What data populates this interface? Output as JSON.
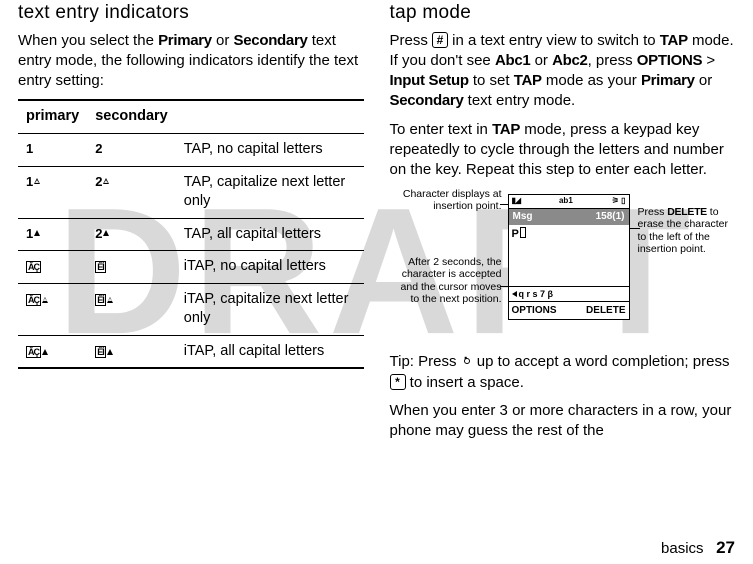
{
  "watermark": "DRAFT",
  "left": {
    "heading": "text entry indicators",
    "intro_pre": "When you select the ",
    "primary_word": "Primary",
    "intro_mid": " or ",
    "secondary_word": "Secondary",
    "intro_post": " text entry mode, the following indicators identify the text entry setting:",
    "table": {
      "h1": "primary",
      "h2": "secondary",
      "rows": [
        {
          "p": "1",
          "s": "2",
          "arrow": "none",
          "desc": "TAP, no capital letters"
        },
        {
          "p": "1",
          "s": "2",
          "arrow": "outline",
          "desc": "TAP, capitalize next letter only"
        },
        {
          "p": "1",
          "s": "2",
          "arrow": "solid",
          "desc": "TAP, all capital letters"
        },
        {
          "p": "box",
          "s": "box",
          "arrow": "none",
          "desc": "iTAP, no capital letters"
        },
        {
          "p": "box",
          "s": "box",
          "arrow": "outline",
          "desc": "iTAP, capitalize next letter only"
        },
        {
          "p": "box",
          "s": "box",
          "arrow": "solid",
          "desc": "iTAP, all capital letters"
        }
      ],
      "box_glyph_p": "ÂÇ",
      "box_glyph_s": "ÊÌ"
    }
  },
  "right": {
    "heading": "tap mode",
    "p1_a": "Press ",
    "p1_hash": "#",
    "p1_b": " in a text entry view to switch to ",
    "p1_tap": "TAP",
    "p1_c": " mode. If you don't see ",
    "p1_abc1": "Abc1",
    "p1_d": " or ",
    "p1_abc2": "Abc2",
    "p1_e": ", press ",
    "p1_options": "OPTIONS",
    "p1_gt": " > ",
    "p1_input": "Input Setup",
    "p1_f": " to set ",
    "p1_g": " mode as your ",
    "p1_h": " or ",
    "p1_i": " text entry mode.",
    "p2_a": "To enter text in ",
    "p2_b": " mode, press a keypad key repeatedly to cycle through the letters and number on the key. Repeat this step to enter each letter.",
    "callout_left1": "Character displays at insertion point.",
    "callout_left2": "After 2 seconds, the character is accepted and the cursor moves to the next position.",
    "callout_right_a": "Press ",
    "callout_right_del": "DELETE",
    "callout_right_b": " to erase the character to the left of the insertion point.",
    "phone": {
      "status_mode": "ab1",
      "title_left": "Msg",
      "title_right": "158(1)",
      "typed_char": "P",
      "candidates": "q r s 7 β",
      "soft_left": "OPTIONS",
      "soft_right": "DELETE"
    },
    "tip_label": "Tip:",
    "tip_a": " Press ",
    "tip_b": " up to accept a word completion; press ",
    "tip_star": "*",
    "tip_c": " to insert a space.",
    "p4": "When you enter 3 or more characters in a row, your phone may guess the rest of the"
  },
  "footer": {
    "section": "basics",
    "page": "27"
  }
}
